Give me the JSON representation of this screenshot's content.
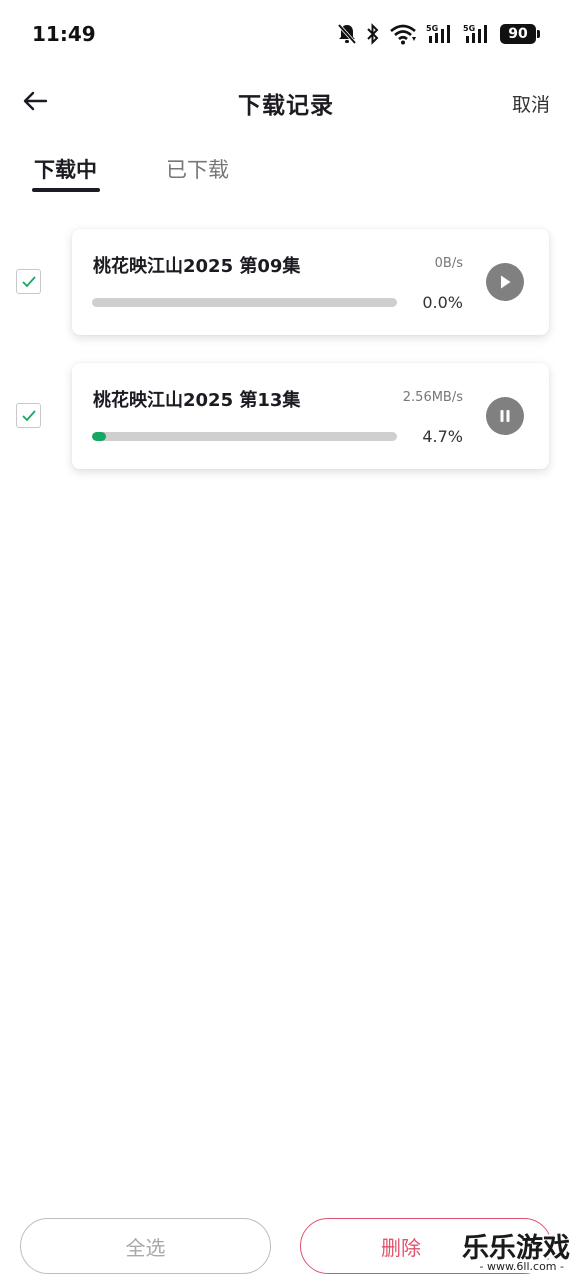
{
  "status_bar": {
    "time": "11:49",
    "battery": "90",
    "icons": [
      "bell-off-icon",
      "bluetooth-icon",
      "wifi-icon",
      "signal-5g-icon",
      "signal-5g-icon",
      "battery-icon"
    ]
  },
  "header": {
    "back_icon": "arrow-left-icon",
    "title": "下载记录",
    "cancel_label": "取消"
  },
  "tabs": [
    {
      "label": "下载中",
      "active": true
    },
    {
      "label": "已下载",
      "active": false
    }
  ],
  "downloads": [
    {
      "title": "桃花映江山2025 第09集",
      "speed": "0B/s",
      "percent_label": "0.0%",
      "progress": 0.0,
      "state": "paused",
      "action_icon": "play-icon",
      "checked": true
    },
    {
      "title": "桃花映江山2025 第13集",
      "speed": "2.56MB/s",
      "percent_label": "4.7%",
      "progress": 0.047,
      "state": "downloading",
      "action_icon": "pause-icon",
      "checked": true
    }
  ],
  "bottom_bar": {
    "select_all_label": "全选",
    "delete_label": "删除"
  },
  "watermark": {
    "text": "乐乐游戏",
    "url": "- www.6ll.com -"
  },
  "colors": {
    "accent_green": "#17a764",
    "delete_red": "#e0536e",
    "control_gray": "#808080"
  }
}
